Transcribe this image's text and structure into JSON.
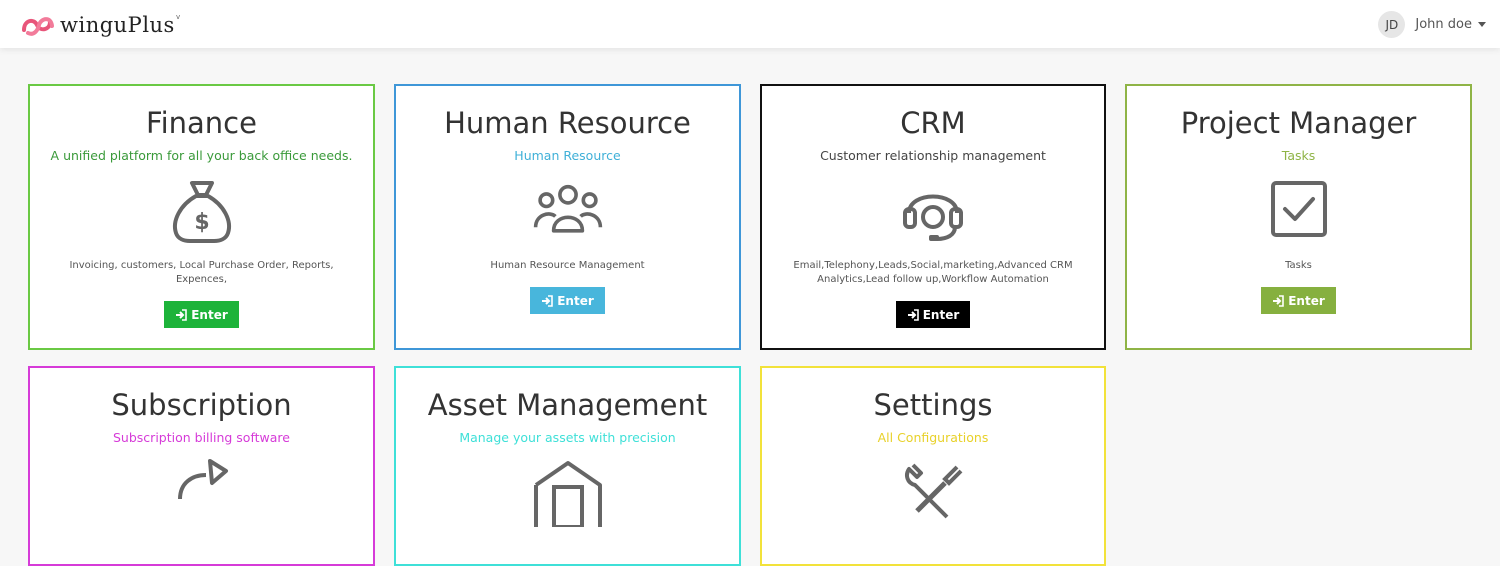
{
  "header": {
    "brand_name": "winguPlus",
    "brand_sup": "v",
    "user_initials": "JD",
    "user_name": "John doe"
  },
  "modules": [
    {
      "title": "Finance",
      "subtitle": "A unified platform for all your back office needs.",
      "description": "Invoicing, customers, Local Purchase Order, Reports, Expences,",
      "button_label": "Enter",
      "icon": "money-bag-icon",
      "color": "#6ac944",
      "subtitle_color": "#3a9a3a",
      "button_color": "#1db33a"
    },
    {
      "title": "Human Resource",
      "subtitle": "Human Resource",
      "description": "Human Resource Management",
      "button_label": "Enter",
      "icon": "users-icon",
      "color": "#3f97d8",
      "subtitle_color": "#3fb0d8",
      "button_color": "#48b6dc"
    },
    {
      "title": "CRM",
      "subtitle": "Customer relationship management",
      "description": "Email,Telephony,Leads,Social,marketing,Advanced CRM Analytics,Lead follow up,Workflow Automation",
      "button_label": "Enter",
      "icon": "headset-icon",
      "color": "#111111",
      "subtitle_color": "#444444",
      "button_color": "#000000"
    },
    {
      "title": "Project Manager",
      "subtitle": "Tasks",
      "description": "Tasks",
      "button_label": "Enter",
      "icon": "checkbox-icon",
      "color": "#8fb446",
      "subtitle_color": "#8fb446",
      "button_color": "#86b03f"
    },
    {
      "title": "Subscription",
      "subtitle": "Subscription billing software",
      "icon": "refresh-icon",
      "color": "#d63bd8",
      "subtitle_color": "#d63bd8"
    },
    {
      "title": "Asset Management",
      "subtitle": "Manage your assets with precision",
      "icon": "warehouse-icon",
      "color": "#3fe0d8",
      "subtitle_color": "#3fe0d8"
    },
    {
      "title": "Settings",
      "subtitle": "All Configurations",
      "icon": "tools-icon",
      "color": "#f2e23a",
      "subtitle_color": "#e8d12a"
    }
  ]
}
